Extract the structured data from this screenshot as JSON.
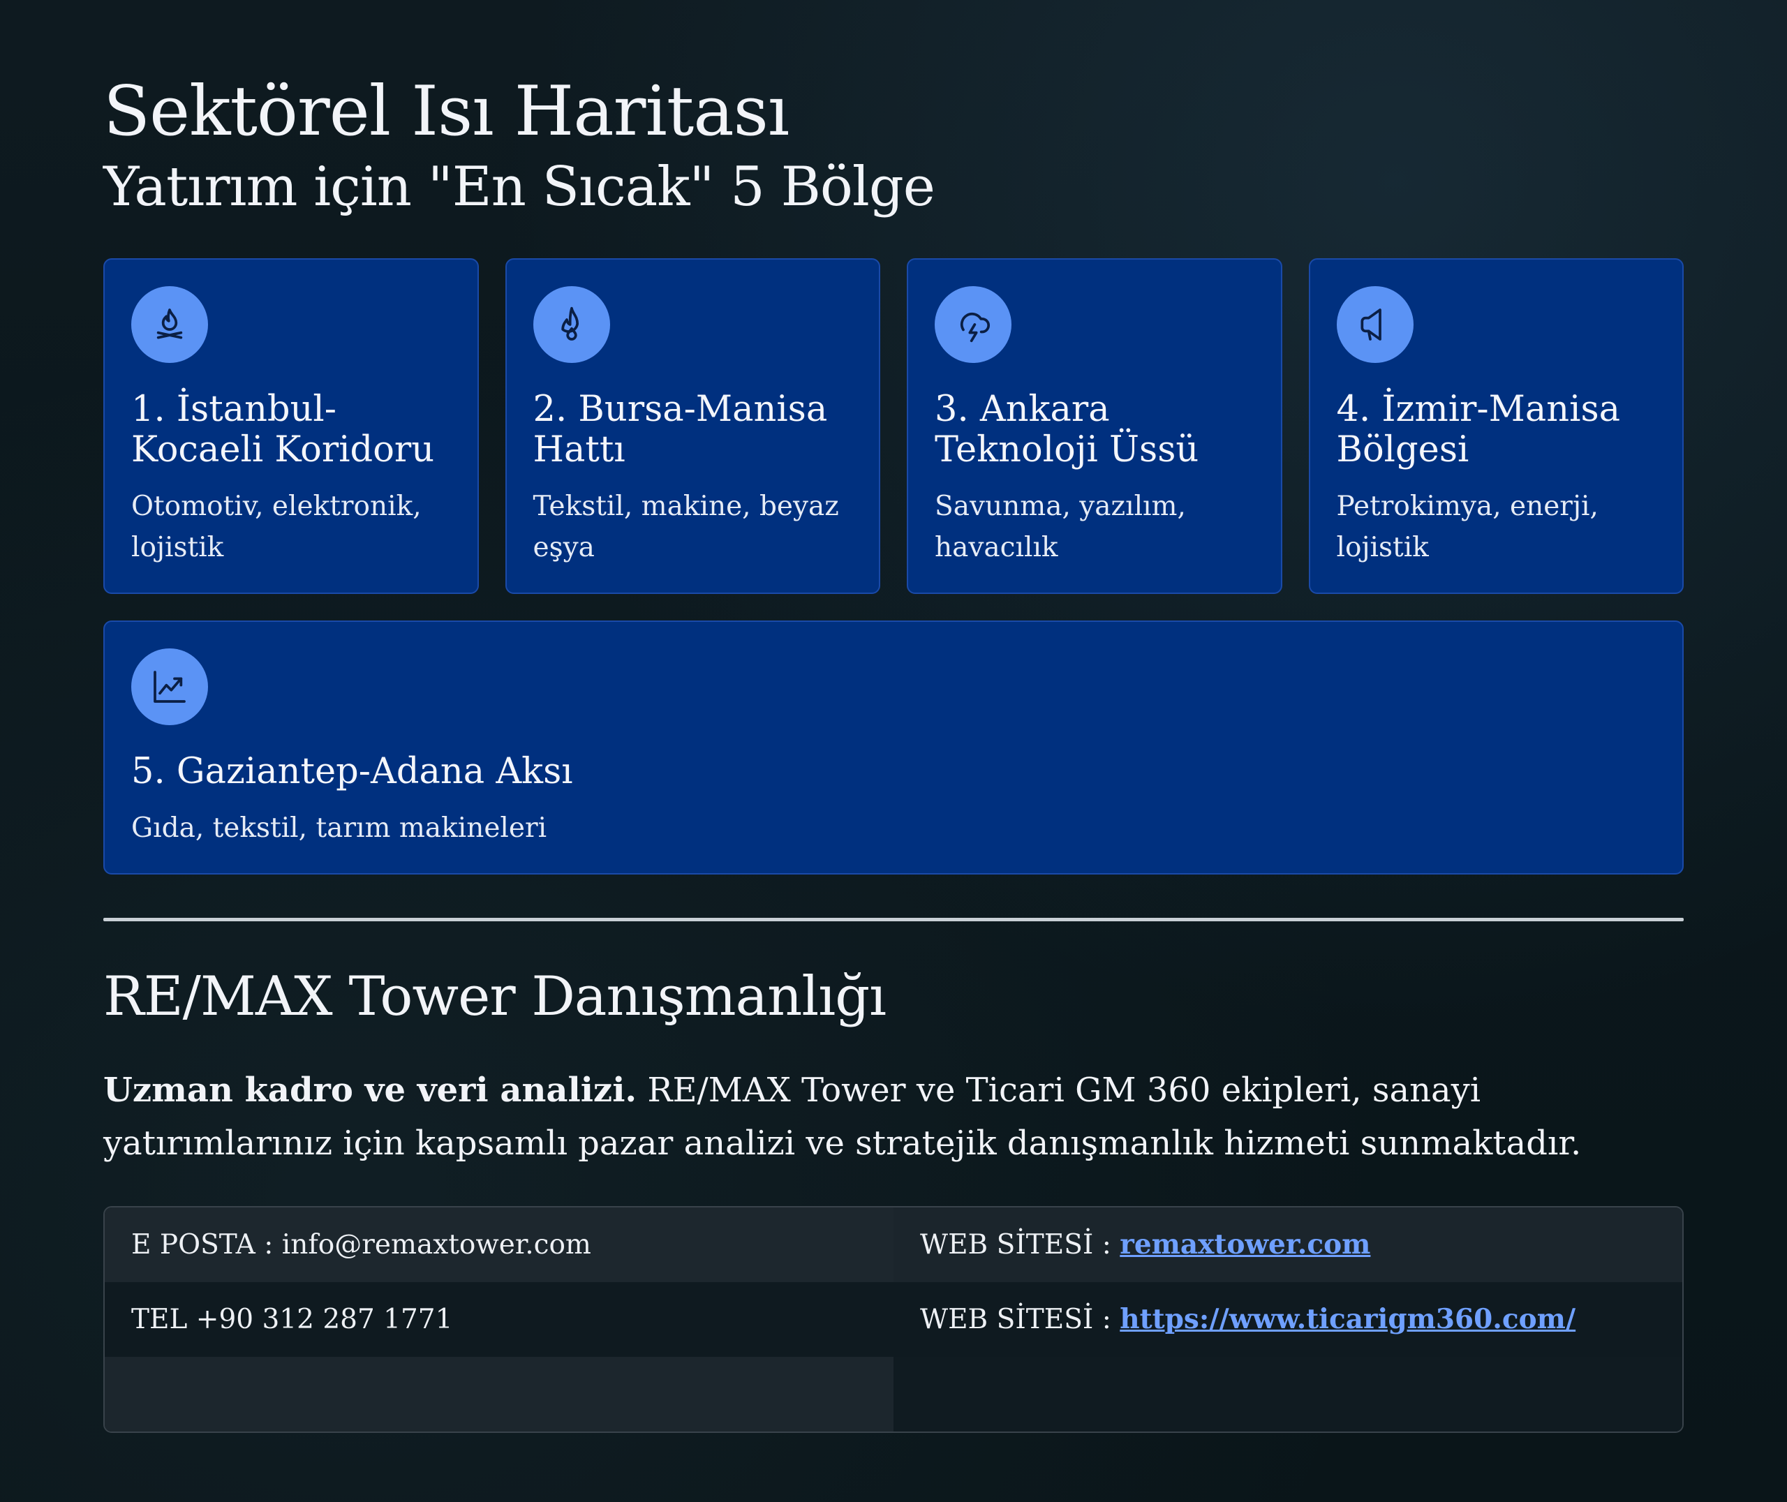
{
  "header": {
    "title": "Sektörel Isı Haritası",
    "subtitle": "Yatırım için \"En Sıcak\" 5 Bölge"
  },
  "regions": [
    {
      "icon": "campfire-icon",
      "title": "1. İstanbul-Kocaeli Koridoru",
      "desc": "Otomotiv, elektronik, lojistik"
    },
    {
      "icon": "flame-icon",
      "title": "2. Bursa-Manisa Hattı",
      "desc": "Tekstil, makine, beyaz eşya"
    },
    {
      "icon": "cloud-lightning-icon",
      "title": "3. Ankara Teknoloji Üssü",
      "desc": "Savunma, yazılım, havacılık"
    },
    {
      "icon": "megaphone-icon",
      "title": "4. İzmir-Manisa Bölgesi",
      "desc": "Petrokimya, enerji, lojistik"
    },
    {
      "icon": "trending-up-icon",
      "title": "5. Gaziantep-Adana Aksı",
      "desc": "Gıda, tekstil, tarım makineleri"
    }
  ],
  "consulting": {
    "title": "RE/MAX Tower Danışmanlığı",
    "lead_bold": "Uzman kadro ve veri analizi.",
    "lead_text": " RE/MAX Tower ve Ticari GM 360 ekipleri, sanayi yatırımlarınız için kapsamlı pazar analizi ve stratejik danışmanlık hizmeti sunmaktadır."
  },
  "contact": {
    "email_label": "E POSTA : info@remaxtower.com",
    "tel_label": "TEL +90 312 287 1771",
    "web1_prefix": "WEB SİTESİ : ",
    "web1_link": "remaxtower.com",
    "web2_prefix": "WEB SİTESİ : ",
    "web2_link": "https://www.ticarigm360.com/"
  },
  "colors": {
    "card_bg": "#00307f",
    "icon_bg": "#5b93f5",
    "link": "#6fa0ff"
  }
}
